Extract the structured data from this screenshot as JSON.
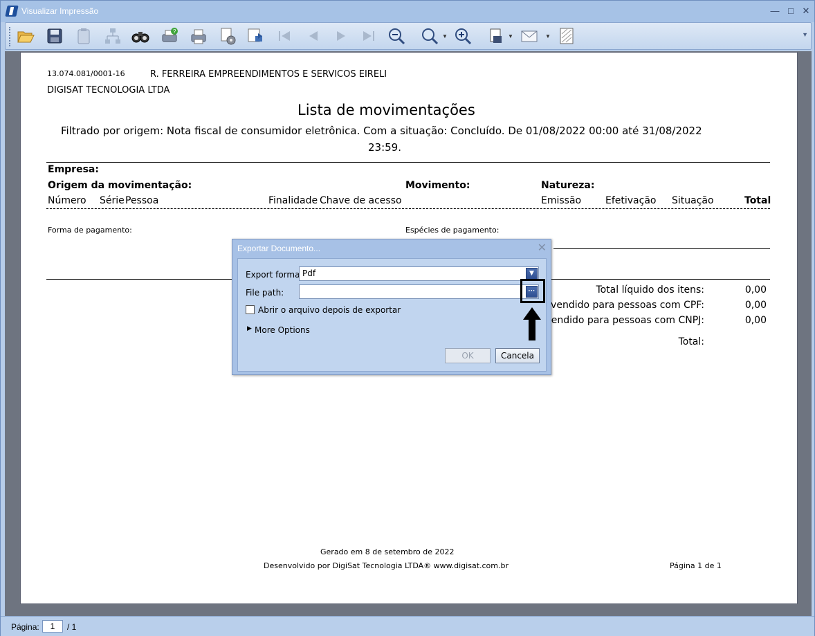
{
  "window": {
    "title": "Visualizar Impressão"
  },
  "toolbar": {
    "icons": [
      "open-folder-icon",
      "save-icon",
      "clipboard-icon",
      "tree-icon",
      "binoculars-icon",
      "print-setup-icon",
      "print-icon",
      "page-setup-icon",
      "export-page-icon",
      "first-page-icon",
      "previous-page-icon",
      "next-page-icon",
      "last-page-icon",
      "zoom-out-icon",
      "zoom-icon",
      "zoom-in-icon",
      "export-icon",
      "email-icon",
      "watermark-icon"
    ]
  },
  "report": {
    "cnpj": "13.074.081/0001-16",
    "company": "R. FERREIRA EMPREENDIMENTOS E SERVICOS EIRELI",
    "developer_company": "DIGISAT TECNOLOGIA LTDA",
    "title": "Lista de movimentações",
    "filter_line1": "Filtrado por origem: Nota fiscal de consumidor eletrônica. Com a situação: Concluído. De 01/08/2022 00:00 até 31/08/2022",
    "filter_line2": "23:59.",
    "empresa_label": "Empresa:",
    "origem_label": "Origem da movimentação:",
    "movimento_label": "Movimento:",
    "natureza_label": "Natureza:",
    "columns": {
      "numero": "Número",
      "serie": "Série",
      "pessoa": "Pessoa",
      "finalidade": "Finalidade",
      "chave": "Chave de acesso",
      "emissao": "Emissão",
      "efetivacao": "Efetivação",
      "situacao": "Situação",
      "total": "Total"
    },
    "forma_pagamento": "Forma de pagamento:",
    "especies_pagamento": "Espécies de pagamento:",
    "totals": {
      "liquido_label": "Total líquido dos itens:",
      "liquido_value": "0,00",
      "cpf_label": "al vendido para pessoas com CPF:",
      "cpf_value": "0,00",
      "cnpj_label": "vendido para pessoas com CNPJ:",
      "cnpj_value": "0,00",
      "total_label": "Total:"
    },
    "footer": {
      "generated": "Gerado em 8 de setembro de 2022",
      "developed": "Desenvolvido por DigiSat Tecnologia LTDA®   www.digisat.com.br",
      "page": "Página 1 de 1"
    }
  },
  "dialog": {
    "title": "Exportar Documento...",
    "export_format_label": "Export format:",
    "export_format_value": "Pdf",
    "file_path_label": "File path:",
    "file_path_value": "",
    "open_after_label": "Abrir o arquivo depois de exportar",
    "more_options_label": "More Options",
    "ok_label": "OK",
    "cancel_label": "Cancela"
  },
  "status": {
    "page_label": "Página:",
    "current_page": "1",
    "total_pages": "/ 1"
  }
}
